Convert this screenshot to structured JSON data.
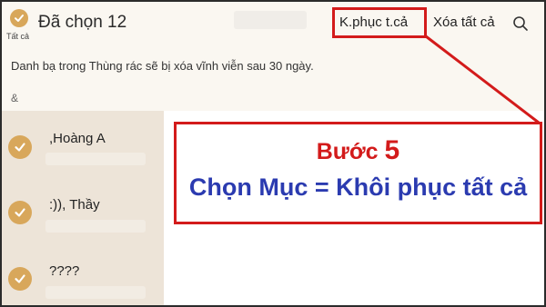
{
  "header": {
    "select_all_label": "Tất cả",
    "title": "Đã chọn 12",
    "restore_label": "K.phục t.cả",
    "delete_all_label": "Xóa tất cả"
  },
  "notice": "Danh bạ trong Thùng rác sẽ bị xóa vĩnh viễn sau 30 ngày.",
  "section_header": "&",
  "contacts": [
    {
      "name": ",Hoàng A"
    },
    {
      "name": ":)), Thầy"
    },
    {
      "name": "????"
    }
  ],
  "annotation": {
    "step_prefix": "Bước",
    "step_number": "5",
    "instruction": "Chọn Mục = Khôi phục tất cả"
  },
  "colors": {
    "accent": "#d8a75b",
    "highlight": "#d31b1b",
    "instruction_text": "#2b3bb0"
  }
}
